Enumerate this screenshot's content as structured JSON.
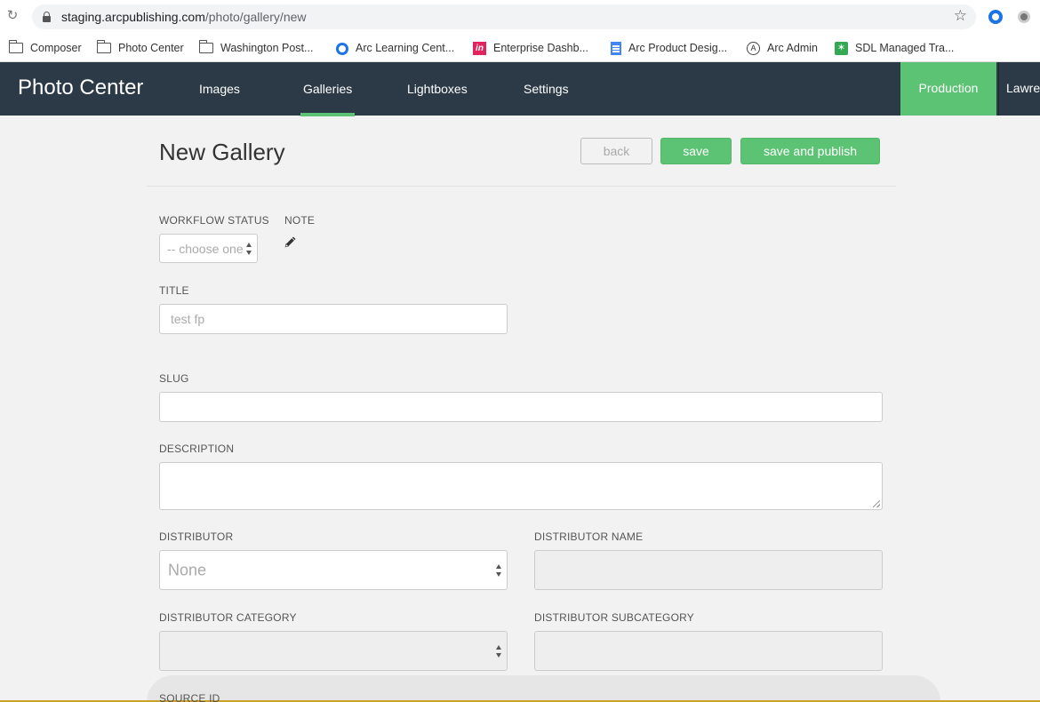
{
  "browser": {
    "url_host": "staging.arcpublishing.com",
    "url_path": "/photo/gallery/new",
    "bookmarks": [
      {
        "label": "Composer",
        "icon": "folder-icon"
      },
      {
        "label": "Photo Center",
        "icon": "folder-icon"
      },
      {
        "label": "Washington Post...",
        "icon": "folder-icon"
      },
      {
        "label": "Arc Learning Cent...",
        "icon": "arc-learning-icon"
      },
      {
        "label": "Enterprise Dashb...",
        "icon": "invision-icon"
      },
      {
        "label": "Arc Product Desig...",
        "icon": "google-doc-icon"
      },
      {
        "label": "Arc Admin",
        "icon": "arc-admin-icon"
      },
      {
        "label": "SDL Managed Tra...",
        "icon": "sdl-icon"
      }
    ]
  },
  "nav": {
    "brand": "Photo Center",
    "tabs": [
      {
        "label": "Images",
        "active": false
      },
      {
        "label": "Galleries",
        "active": true
      },
      {
        "label": "Lightboxes",
        "active": false
      },
      {
        "label": "Settings",
        "active": false
      }
    ],
    "environment": "Production",
    "user": "Lawrence",
    "accent_color": "#5cc274",
    "bg_color": "#2b3a46"
  },
  "page": {
    "title": "New Gallery",
    "buttons": {
      "back": "back",
      "save": "save",
      "save_publish": "save and publish"
    }
  },
  "form": {
    "workflow_status": {
      "label": "WORKFLOW STATUS",
      "value": "-- choose one --"
    },
    "note": {
      "label": "NOTE"
    },
    "title": {
      "label": "TITLE",
      "placeholder": "test fp"
    },
    "slug": {
      "label": "SLUG",
      "value": ""
    },
    "description": {
      "label": "DESCRIPTION",
      "value": ""
    },
    "distributor": {
      "label": "DISTRIBUTOR",
      "value": "None"
    },
    "distributor_name": {
      "label": "DISTRIBUTOR NAME",
      "value": ""
    },
    "distributor_category": {
      "label": "DISTRIBUTOR CATEGORY",
      "value": ""
    },
    "distributor_subcategory": {
      "label": "DISTRIBUTOR SUBCATEGORY",
      "value": ""
    },
    "source_id": {
      "label": "SOURCE ID"
    }
  }
}
